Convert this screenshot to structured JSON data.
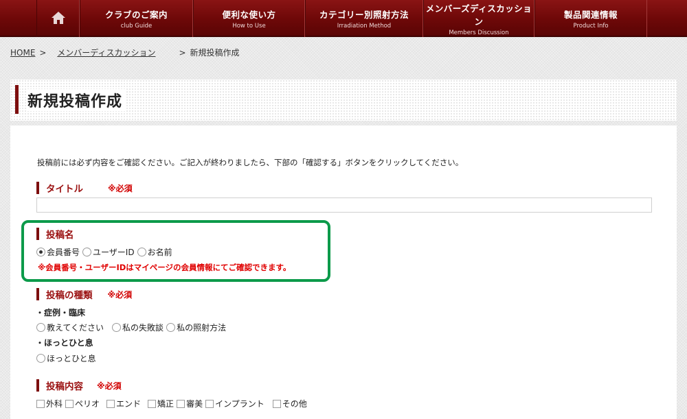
{
  "nav": {
    "home_icon": "home-icon",
    "items": [
      {
        "jp": "クラブのご案内",
        "en": "club Guide"
      },
      {
        "jp": "便利な使い方",
        "en": "How to Use"
      },
      {
        "jp": "カテゴリー別照射方法",
        "en": "Irradiation Method"
      },
      {
        "jp": "メンバーズディスカッション",
        "en": "Members Discussion"
      },
      {
        "jp": "製品関連情報",
        "en": "Product Info"
      }
    ]
  },
  "breadcrumb": {
    "home": "HOME",
    "parent": "メンバーディスカッション",
    "current": "新規投稿作成",
    "sep": ">"
  },
  "page": {
    "title": "新規投稿作成",
    "intro": "投稿前には必ず内容をご確認ください。ご記入が終わりましたら、下部の「確認する」ボタンをクリックしてください。"
  },
  "form": {
    "required": "※必須",
    "title_field": {
      "label": "タイトル",
      "value": ""
    },
    "poster_name": {
      "label": "投稿名",
      "options": [
        "会員番号",
        "ユーザーID",
        "お名前"
      ],
      "selected": "会員番号",
      "notice": "※会員番号・ユーザーIDはマイページの会員情報にてご確認できます。"
    },
    "post_type": {
      "label": "投稿の種類",
      "groups": [
        {
          "label": "・症例・臨床",
          "options": [
            "教えてください",
            "私の失敗談",
            "私の照射方法"
          ]
        },
        {
          "label": "・ほっとひと息",
          "options": [
            "ほっとひと息"
          ]
        }
      ]
    },
    "post_content": {
      "label": "投稿内容",
      "options": [
        "外科",
        "ペリオ",
        "エンド",
        "矯正",
        "審美",
        "インプラント",
        "その他"
      ]
    }
  },
  "colors": {
    "nav_bg": "#6d0808",
    "accent": "#7d0e0e",
    "required_red": "#d10000",
    "highlight_green": "#0c9a4a"
  }
}
